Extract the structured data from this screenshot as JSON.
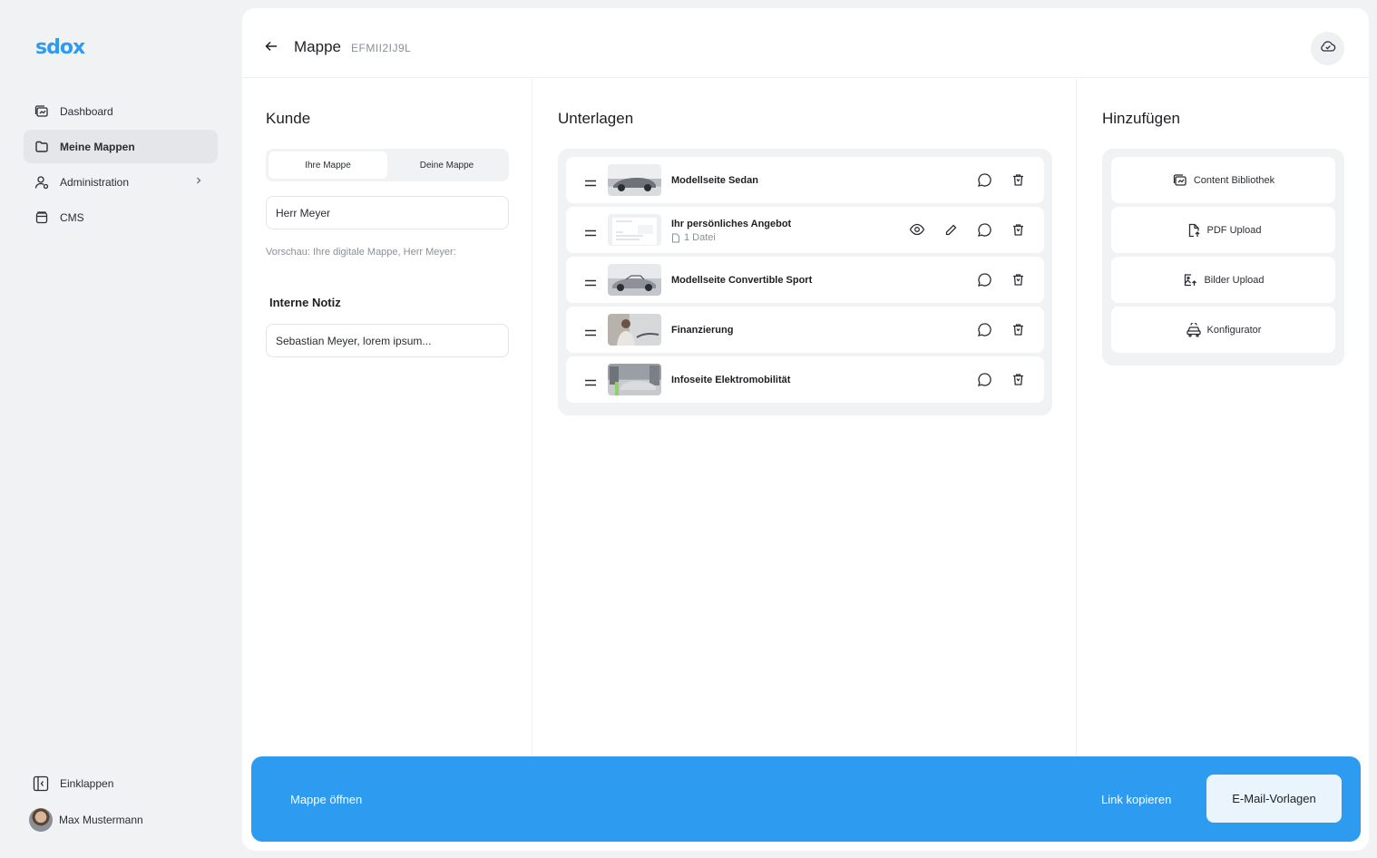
{
  "app": {
    "logo": "sdox"
  },
  "sidebar": {
    "items": [
      {
        "label": "Dashboard",
        "icon": "dashboard-icon"
      },
      {
        "label": "Meine Mappen",
        "icon": "folder-icon",
        "active": true
      },
      {
        "label": "Administration",
        "icon": "user-icon",
        "has_submenu": true
      },
      {
        "label": "CMS",
        "icon": "database-icon"
      }
    ],
    "collapse_label": "Einklappen",
    "user_name": "Max Mustermann"
  },
  "header": {
    "title": "Mappe",
    "id": "EFMII2IJ9L",
    "cloud_icon": "cloud-check-icon"
  },
  "kunde": {
    "title": "Kunde",
    "toggle": [
      "Ihre Mappe",
      "Deine Mappe"
    ],
    "toggle_active": 0,
    "name_value": "Herr Meyer",
    "preview_text": "Vorschau: Ihre digitale Mappe, Herr Meyer:",
    "note_title": "Interne Notiz",
    "note_value": "Sebastian Meyer, lorem ipsum..."
  },
  "unterlagen": {
    "title": "Unterlagen",
    "items": [
      {
        "name": "Modellseite Sedan",
        "meta": "",
        "actions": [
          "comment",
          "delete"
        ]
      },
      {
        "name": "Ihr persönliches Angebot",
        "meta": "1 Datei",
        "actions": [
          "view",
          "edit",
          "comment",
          "delete"
        ]
      },
      {
        "name": "Modellseite Convertible Sport",
        "meta": "",
        "actions": [
          "comment",
          "delete"
        ]
      },
      {
        "name": "Finanzierung",
        "meta": "",
        "actions": [
          "comment",
          "delete"
        ]
      },
      {
        "name": "Infoseite Elektromobilität",
        "meta": "",
        "actions": [
          "comment",
          "delete"
        ]
      }
    ]
  },
  "hinzufuegen": {
    "title": "Hinzufügen",
    "items": [
      {
        "label": "Content Bibliothek",
        "icon": "library-icon"
      },
      {
        "label": "PDF Upload",
        "icon": "file-upload-icon"
      },
      {
        "label": "Bilder Upload",
        "icon": "image-upload-icon"
      },
      {
        "label": "Konfigurator",
        "icon": "car-configurator-icon"
      }
    ]
  },
  "bottom_bar": {
    "open_label": "Mappe öffnen",
    "copy_link_label": "Link kopieren",
    "email_templates_label": "E-Mail-Vorlagen"
  },
  "colors": {
    "accent": "#2d9bf0",
    "background": "#f1f2f4"
  }
}
